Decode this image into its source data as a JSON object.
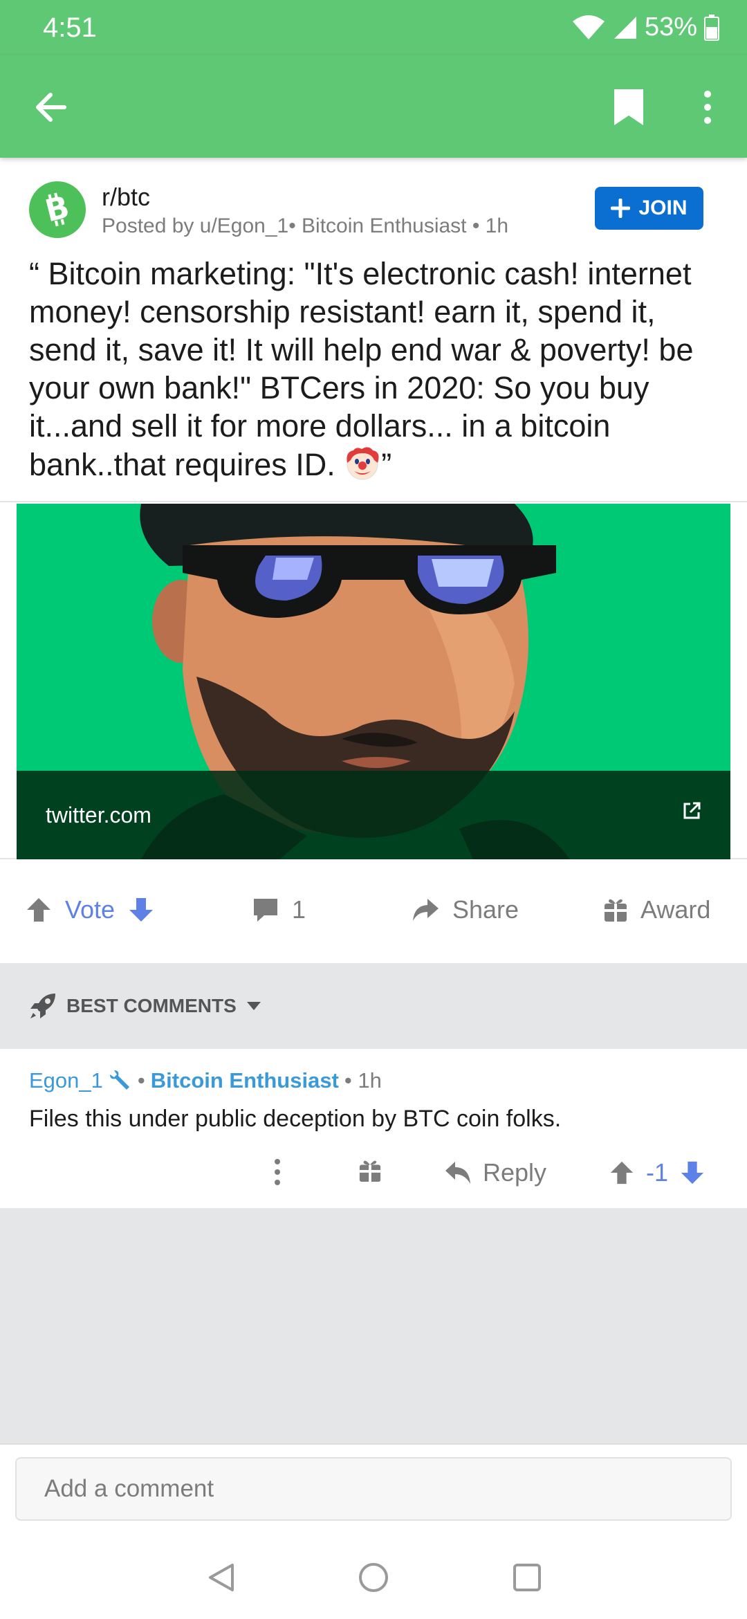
{
  "status_bar": {
    "time": "4:51",
    "battery": "53%"
  },
  "subreddit": {
    "name": "r/btc",
    "meta": "Posted by u/Egon_1• Bitcoin Enthusiast • 1h",
    "join_label": "JOIN"
  },
  "post": {
    "title": "“ Bitcoin marketing: \"It's electronic cash! internet money! censorship resistant! earn it, spend it, send it, save it! It will help end war & poverty! be your own bank!\" BTCers in 2020: So you buy it...and sell it for more dollars... in a bitcoin bank..that requires ID.",
    "title_end": "”",
    "link_domain": "twitter.com"
  },
  "actions": {
    "vote_label": "Vote",
    "comments_count": "1",
    "share_label": "Share",
    "award_label": "Award"
  },
  "sort": {
    "label": "BEST COMMENTS"
  },
  "comment": {
    "author": "Egon_1",
    "flair": "Bitcoin Enthusiast",
    "age": "• 1h",
    "body": "Files this under public deception by BTC coin folks.",
    "reply_label": "Reply",
    "score": "-1"
  },
  "composer": {
    "placeholder": "Add a comment"
  },
  "colors": {
    "header_green": "#5ec874",
    "join_blue": "#0a6fd1",
    "vote_blue": "#5d81e6",
    "link_green": "#00c976"
  },
  "icons": [
    "back-arrow-icon",
    "bookmark-icon",
    "more-vertical-icon",
    "bitcoin-cash-logo",
    "plus-icon",
    "clown-emoji-icon",
    "external-link-icon",
    "upvote-icon",
    "downvote-icon",
    "comment-bubble-icon",
    "share-arrow-icon",
    "gift-icon",
    "rocket-icon",
    "caret-down-icon",
    "wrench-icon",
    "reply-icon"
  ]
}
